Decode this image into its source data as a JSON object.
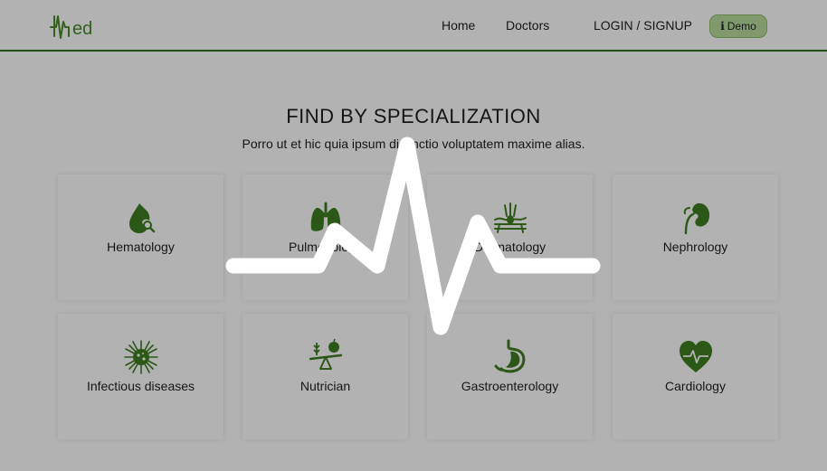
{
  "nav": {
    "logo_text": "ed",
    "home": "Home",
    "doctors": "Doctors",
    "login": "LOGIN / SIGNUP",
    "demo": "Demo",
    "demo_icon": "i"
  },
  "section": {
    "title": "FIND BY SPECIALIZATION",
    "subtitle": "Porro ut et hic quia ipsum distinctio voluptatem maxime alias."
  },
  "specializations": [
    {
      "label": "Hematology",
      "icon": "blood-drop-icon"
    },
    {
      "label": "Pulmonology",
      "icon": "lungs-icon"
    },
    {
      "label": "Dermatology",
      "icon": "skin-icon"
    },
    {
      "label": "Nephrology",
      "icon": "kidney-icon"
    },
    {
      "label": "Infectious diseases",
      "icon": "virus-icon"
    },
    {
      "label": "Nutrician",
      "icon": "nutrition-scale-icon"
    },
    {
      "label": "Gastroenterology",
      "icon": "stomach-icon"
    },
    {
      "label": "Cardiology",
      "icon": "heart-pulse-icon"
    }
  ],
  "colors": {
    "brand_green": "#2f6b1f",
    "demo_bg": "#b9dd9d",
    "overlay": "rgba(0,0,0,0.30)"
  }
}
